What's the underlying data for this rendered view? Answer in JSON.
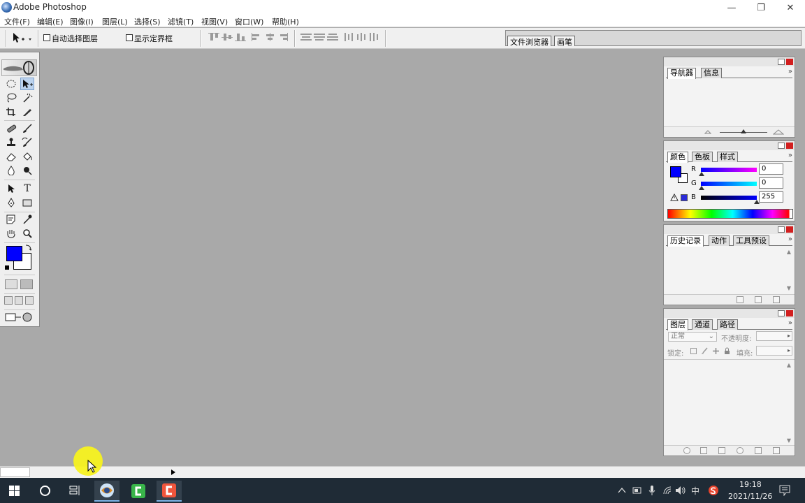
{
  "window": {
    "title": "Adobe Photoshop",
    "minimize": "—",
    "restore": "❐",
    "close": "✕"
  },
  "menu": [
    "文件(F)",
    "编辑(E)",
    "图像(I)",
    "图层(L)",
    "选择(S)",
    "滤镜(T)",
    "视图(V)",
    "窗口(W)",
    "帮助(H)"
  ],
  "options": {
    "auto_select": "自动选择图层",
    "show_bounds": "显示定界框"
  },
  "palette_well": {
    "tabs": [
      "文件浏览器",
      "画笔"
    ]
  },
  "toolbox": {
    "type_tool": "T"
  },
  "panels": {
    "navigator": {
      "tabs": [
        "导航器",
        "信息"
      ]
    },
    "color": {
      "tabs": [
        "颜色",
        "色板",
        "样式"
      ],
      "labels": [
        "R",
        "G",
        "B"
      ],
      "values": [
        "0",
        "0",
        "255"
      ],
      "fg": "#0000ff"
    },
    "history": {
      "tabs": [
        "历史记录",
        "动作",
        "工具预设"
      ]
    },
    "layers": {
      "tabs": [
        "图层",
        "通道",
        "路径"
      ],
      "blend_mode": "正常",
      "opacity_label": "不透明度:",
      "lock_label": "锁定:",
      "fill_label": "填充:"
    },
    "menu_glyph": "»"
  },
  "taskbar": {
    "time": "19:18",
    "date": "2021/11/26",
    "ime": "中"
  }
}
